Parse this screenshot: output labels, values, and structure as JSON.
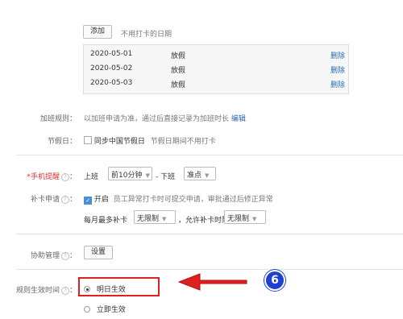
{
  "holiday": {
    "add_button": "添加",
    "hint": "不用打卡的日期",
    "rows": [
      {
        "date": "2020-05-01",
        "type": "放假",
        "action": "删除"
      },
      {
        "date": "2020-05-02",
        "type": "放假",
        "action": "删除"
      },
      {
        "date": "2020-05-03",
        "type": "放假",
        "action": "删除"
      }
    ]
  },
  "overtime": {
    "label": "加班规则：",
    "text": "以加班申请为准，通过后直接记录为加班时长",
    "edit": "编辑"
  },
  "festival": {
    "label": "节假日：",
    "checkbox_label": "同步中国节假日",
    "hint": "节假日期间不用打卡"
  },
  "reminder": {
    "label": "*手机提醒",
    "colon": "：",
    "on_duty": "上班",
    "on_select": "前10分钟",
    "separator": "- 下班",
    "off_select": "准点"
  },
  "makeup": {
    "label": "补卡申请",
    "colon": "：",
    "checkbox_label": "开启",
    "desc": "员工异常打卡时可提交申请，审批通过后修正异常",
    "monthly_label": "每月最多补卡",
    "monthly_select": "无限制",
    "days_label": "，允许补卡时限为",
    "days_select": "无限制"
  },
  "assist": {
    "label": "协助管理",
    "colon": "：",
    "button": "设置"
  },
  "effective": {
    "label": "规则生效时间",
    "colon": "：",
    "options": [
      {
        "label": "明日生效",
        "selected": true
      },
      {
        "label": "立即生效",
        "selected": false
      }
    ]
  },
  "annotation": {
    "step_number": "6",
    "highlight_color": "#e02020",
    "badge_color": "#1f3fd0"
  }
}
